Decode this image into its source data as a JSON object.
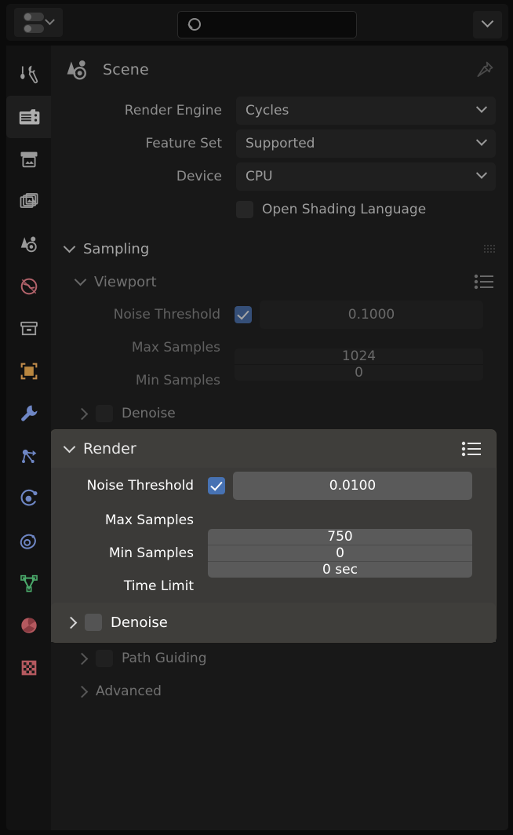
{
  "topbar": {
    "editor_type_icon": "properties-editor-icon",
    "editor_type_chevron": "chevron-down-icon",
    "search_placeholder": "",
    "search_value": "",
    "search_icon": "search-icon",
    "right_menu_icon": "chevron-down-icon"
  },
  "tabs": [
    {
      "id": "tool",
      "name": "tab-tool",
      "icon": "screwdriver-wrench-icon",
      "color": "#9a9a9a",
      "active": false
    },
    {
      "id": "render",
      "name": "tab-render",
      "icon": "camera-back-icon",
      "color": "#b0b0b0",
      "active": true
    },
    {
      "id": "output",
      "name": "tab-output",
      "icon": "printer-icon",
      "color": "#9a9a9a",
      "active": false
    },
    {
      "id": "view-layer",
      "name": "tab-view-layer",
      "icon": "images-icon",
      "color": "#9a9a9a",
      "active": false
    },
    {
      "id": "scene",
      "name": "tab-scene",
      "icon": "scene-cone-sphere-icon",
      "color": "#9a9a9a",
      "active": false
    },
    {
      "id": "world",
      "name": "tab-world",
      "icon": "world-globe-icon",
      "color": "#b3636b",
      "active": false
    },
    {
      "id": "collection",
      "name": "tab-collection",
      "icon": "collection-box-icon",
      "color": "#9a9a9a",
      "active": false
    },
    {
      "id": "object",
      "name": "tab-object",
      "icon": "object-square-icon",
      "color": "#c08b4a",
      "active": false
    },
    {
      "id": "modifiers",
      "name": "tab-modifiers",
      "icon": "wrench-icon",
      "color": "#6e86c4",
      "active": false
    },
    {
      "id": "particles",
      "name": "tab-particles",
      "icon": "particles-icon",
      "color": "#6e86c4",
      "active": false
    },
    {
      "id": "physics",
      "name": "tab-physics",
      "icon": "physics-orbit-icon",
      "color": "#6e86c4",
      "active": false
    },
    {
      "id": "constraints",
      "name": "tab-object-constraints",
      "icon": "constraint-clamp-icon",
      "color": "#6e86c4",
      "active": false
    },
    {
      "id": "data",
      "name": "tab-object-data",
      "icon": "mesh-data-triangle-icon",
      "color": "#4aa86a",
      "active": false
    },
    {
      "id": "material",
      "name": "tab-material",
      "icon": "material-sphere-icon",
      "color": "#b5595f",
      "active": false
    },
    {
      "id": "texture",
      "name": "tab-texture",
      "icon": "checker-texture-icon",
      "color": "#b5595f",
      "active": false
    }
  ],
  "breadcrumb": {
    "icon": "scene-cone-sphere-icon",
    "label": "Scene",
    "pin_icon": "pin-icon"
  },
  "engine": {
    "render_engine_label": "Render Engine",
    "render_engine_value": "Cycles",
    "feature_set_label": "Feature Set",
    "feature_set_value": "Supported",
    "device_label": "Device",
    "device_value": "CPU",
    "osl_label": "Open Shading Language",
    "osl_checked": false,
    "chevron_icon": "chevron-down-icon"
  },
  "sampling": {
    "title": "Sampling",
    "expanded": true,
    "grip_icon": "grip-dots-icon",
    "viewport": {
      "title": "Viewport",
      "expanded": true,
      "preset_icon": "preset-list-icon",
      "noise_threshold_label": "Noise Threshold",
      "noise_threshold_checked": true,
      "noise_threshold_value": "0.1000",
      "max_samples_label": "Max Samples",
      "max_samples_value": "1024",
      "min_samples_label": "Min Samples",
      "min_samples_value": "0",
      "denoise_label": "Denoise",
      "denoise_checked": false,
      "denoise_expanded": false
    },
    "render": {
      "title": "Render",
      "expanded": true,
      "highlighted": true,
      "preset_icon": "preset-list-icon",
      "noise_threshold_label": "Noise Threshold",
      "noise_threshold_checked": true,
      "noise_threshold_value": "0.0100",
      "max_samples_label": "Max Samples",
      "max_samples_value": "750",
      "min_samples_label": "Min Samples",
      "min_samples_value": "0",
      "time_limit_label": "Time Limit",
      "time_limit_value": "0 sec",
      "denoise_label": "Denoise",
      "denoise_checked": false,
      "denoise_expanded": false
    },
    "path_guiding": {
      "title": "Path Guiding",
      "checked": false,
      "expanded": false
    },
    "advanced": {
      "title": "Advanced",
      "expanded": false
    }
  },
  "colors": {
    "accent_blue": "#4772b3",
    "panel_bg": "#181818",
    "highlight_panel": "#3b3a38",
    "highlight_header": "#3f3e3b",
    "field_bg": "#1f1f1f",
    "field_bg_highlight": "#5a5a5a"
  }
}
